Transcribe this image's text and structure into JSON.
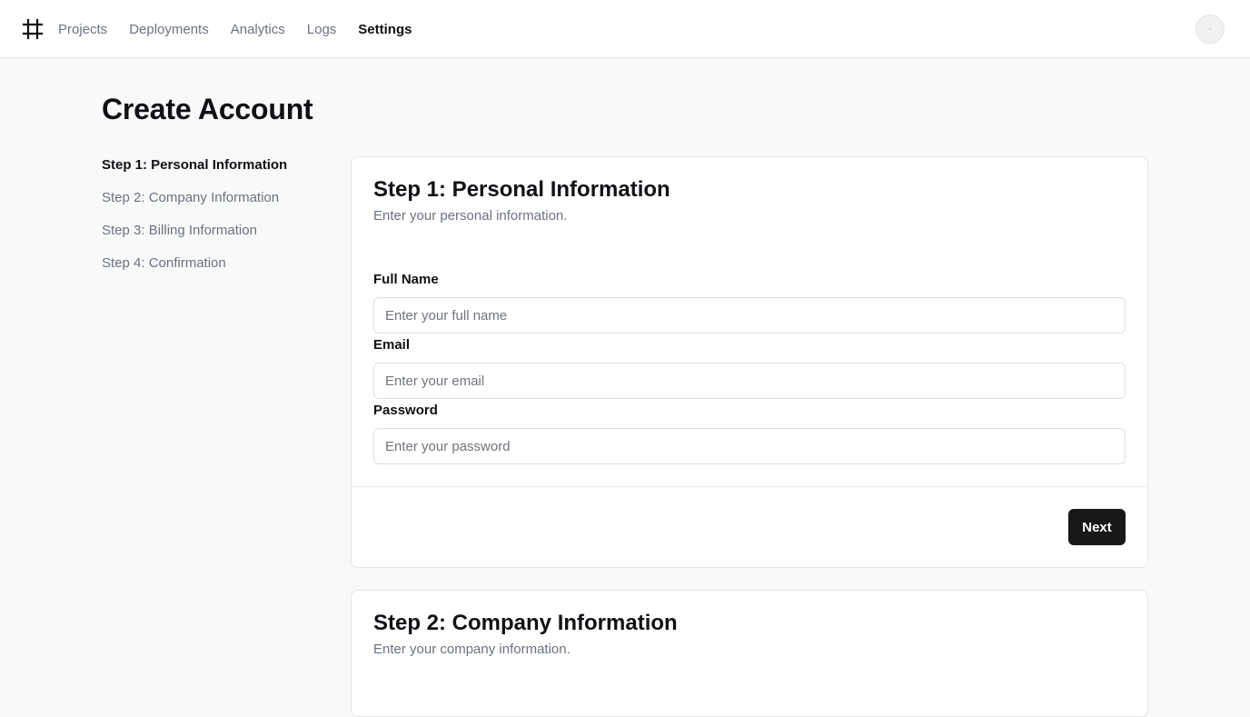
{
  "nav": {
    "items": [
      {
        "label": "Projects",
        "active": false
      },
      {
        "label": "Deployments",
        "active": false
      },
      {
        "label": "Analytics",
        "active": false
      },
      {
        "label": "Logs",
        "active": false
      },
      {
        "label": "Settings",
        "active": true
      }
    ],
    "logo_icon": "hash-frame-icon",
    "avatar_icon": "user-avatar"
  },
  "page": {
    "title": "Create Account"
  },
  "steps": [
    {
      "label": "Step 1: Personal Information",
      "active": true
    },
    {
      "label": "Step 2: Company Information",
      "active": false
    },
    {
      "label": "Step 3: Billing Information",
      "active": false
    },
    {
      "label": "Step 4: Confirmation",
      "active": false
    }
  ],
  "card1": {
    "title": "Step 1: Personal Information",
    "description": "Enter your personal information.",
    "fields": [
      {
        "label": "Full Name",
        "placeholder": "Enter your full name",
        "value": ""
      },
      {
        "label": "Email",
        "placeholder": "Enter your email",
        "value": ""
      },
      {
        "label": "Password",
        "placeholder": "Enter your password",
        "value": ""
      }
    ],
    "next_label": "Next"
  },
  "card2": {
    "title": "Step 2: Company Information",
    "description": "Enter your company information."
  },
  "colors": {
    "background": "#f8f9f9",
    "surface": "#ffffff",
    "primary_button": "#18181b",
    "muted_text": "#6b7280",
    "border": "#e4e6e9"
  }
}
